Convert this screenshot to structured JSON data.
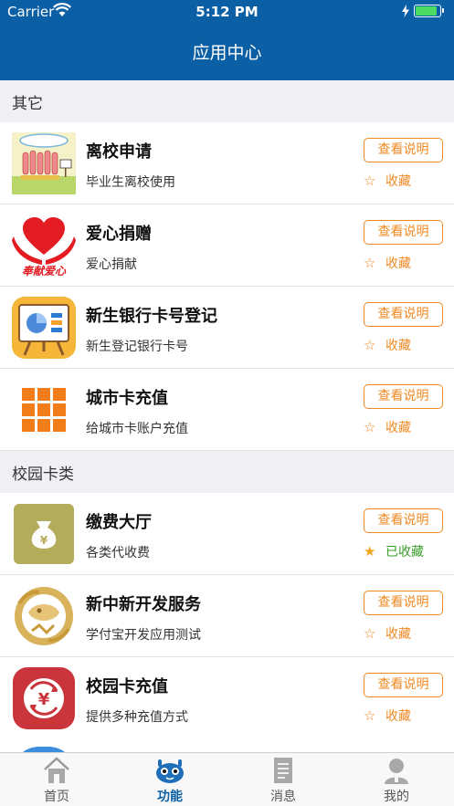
{
  "status": {
    "carrier": "Carrier",
    "time": "5:12 PM",
    "battery_level": 0.9
  },
  "nav": {
    "title": "应用中心"
  },
  "sections": [
    {
      "title": "其它",
      "items": [
        {
          "name": "离校申请",
          "desc": "毕业生离校使用",
          "info": "查看说明",
          "fav_label": "收藏",
          "favorited": false,
          "icon": "graduation-icon"
        },
        {
          "name": "爱心捐赠",
          "desc": "爱心捐献",
          "info": "查看说明",
          "fav_label": "收藏",
          "favorited": false,
          "icon": "heart-donation-icon",
          "logo_text": "奉献爱心"
        },
        {
          "name": "新生银行卡号登记",
          "desc": "新生登记银行卡号",
          "info": "查看说明",
          "fav_label": "收藏",
          "favorited": false,
          "icon": "presentation-board-icon"
        },
        {
          "name": "城市卡充值",
          "desc": "给城市卡账户充值",
          "info": "查看说明",
          "fav_label": "收藏",
          "favorited": false,
          "icon": "grid-icon"
        }
      ]
    },
    {
      "title": "校园卡类",
      "items": [
        {
          "name": "缴费大厅",
          "desc": "各类代收费",
          "info": "查看说明",
          "fav_label": "已收藏",
          "favorited": true,
          "icon": "money-bag-icon"
        },
        {
          "name": "新中新开发服务",
          "desc": "学付宝开发应用测试",
          "info": "查看说明",
          "fav_label": "收藏",
          "favorited": false,
          "icon": "golden-dragon-icon"
        },
        {
          "name": "校园卡充值",
          "desc": "提供多种充值方式",
          "info": "查看说明",
          "fav_label": "收藏",
          "favorited": false,
          "icon": "yen-recharge-icon"
        }
      ]
    }
  ],
  "tabs": [
    {
      "label": "首页",
      "icon": "home-icon",
      "active": false
    },
    {
      "label": "功能",
      "icon": "robot-icon",
      "active": true
    },
    {
      "label": "消息",
      "icon": "document-icon",
      "active": false
    },
    {
      "label": "我的",
      "icon": "person-icon",
      "active": false
    }
  ],
  "colors": {
    "nav": "#0b5fa5",
    "accent": "#f08a24",
    "favorited": "#3a9d2a",
    "star_on": "#f3a31a"
  }
}
